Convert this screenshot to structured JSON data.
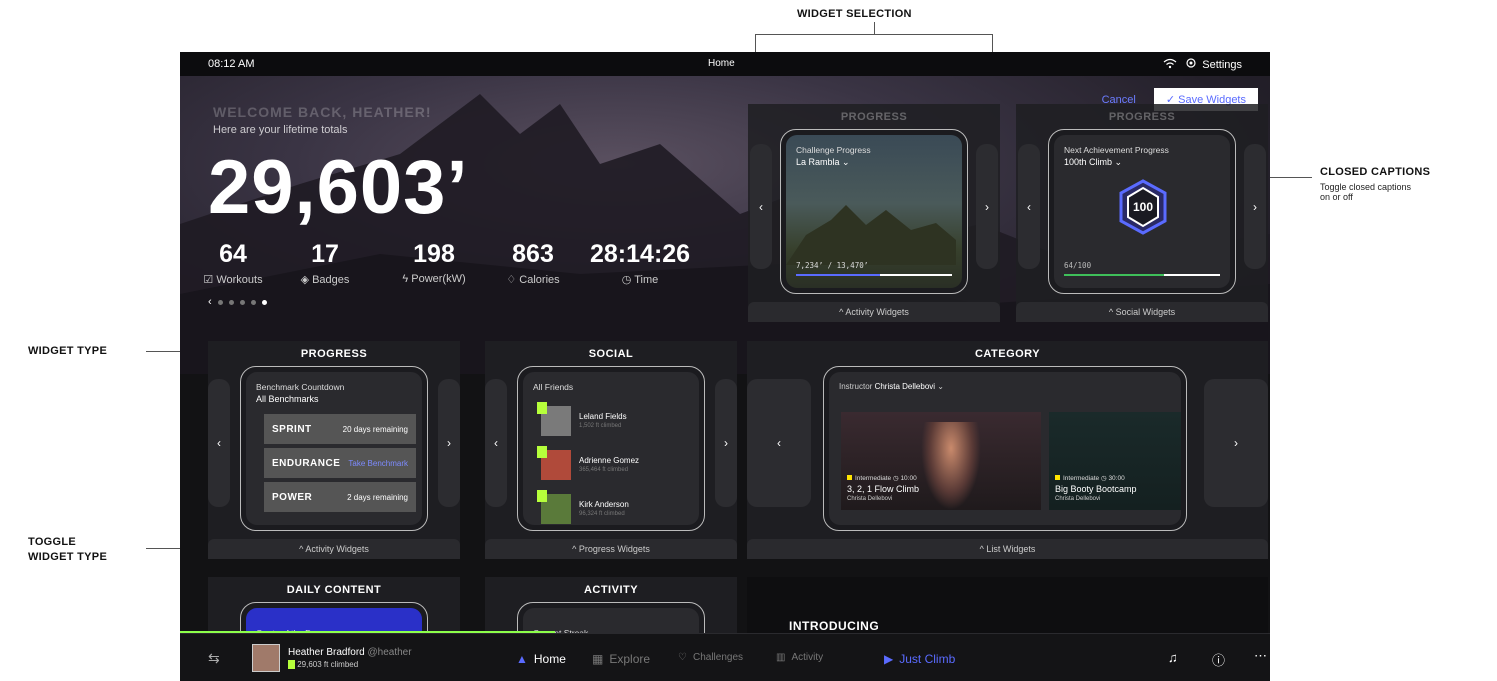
{
  "annotations": {
    "widget_selection": "WIDGET SELECTION",
    "closed_captions_title": "CLOSED CAPTIONS",
    "closed_captions_sub1": "Toggle closed captions",
    "closed_captions_sub2": "on or off",
    "widget_type": "WIDGET TYPE",
    "toggle_widget_type_1": "TOGGLE",
    "toggle_widget_type_2": "WIDGET TYPE"
  },
  "status": {
    "time": "08:12 AM",
    "page": "Home",
    "settings_label": "Settings"
  },
  "hero": {
    "welcome": "WELCOME BACK, HEATHER!",
    "subtitle": "Here are your lifetime totals",
    "total": "29,603’",
    "stats": [
      {
        "value": "64",
        "label": "Workouts",
        "icon": "check-square-icon"
      },
      {
        "value": "17",
        "label": "Badges",
        "icon": "badge-icon"
      },
      {
        "value": "198",
        "label": "Power(kW)",
        "icon": "bolt-icon"
      },
      {
        "value": "863",
        "label": "Calories",
        "icon": "flame-icon"
      },
      {
        "value": "28:14:26",
        "label": "Time",
        "icon": "stopwatch-icon"
      }
    ]
  },
  "edit": {
    "cancel": "Cancel",
    "save": "Save Widgets"
  },
  "widget_picker": [
    {
      "head": "PROGRESS",
      "label": "Challenge Progress",
      "value": "La Rambla",
      "readout": "7,234’ / 13,470’",
      "progress": 0.54,
      "footer": "Activity Widgets"
    },
    {
      "head": "PROGRESS",
      "label": "Next Achievement Progress",
      "value": "100th Climb",
      "badge": "100",
      "readout": "64/100",
      "progress": 0.64,
      "footer": "Social Widgets"
    }
  ],
  "panels": {
    "progress": {
      "head": "PROGRESS",
      "label": "Benchmark Countdown",
      "value": "All Benchmarks",
      "rows": [
        {
          "name": "SPRINT",
          "status": "20 days remaining"
        },
        {
          "name": "ENDURANCE",
          "status": "Take Benchmark"
        },
        {
          "name": "POWER",
          "status": "2 days remaining"
        }
      ],
      "footer": "Activity Widgets"
    },
    "social": {
      "head": "SOCIAL",
      "label": "All Friends",
      "friends": [
        {
          "name": "Leland Fields",
          "feet": "1,502 ft climbed"
        },
        {
          "name": "Adrienne Gomez",
          "feet": "365,464 ft climbed"
        },
        {
          "name": "Kirk Anderson",
          "feet": "96,324 ft climbed"
        }
      ],
      "footer": "Progress Widgets"
    },
    "category": {
      "head": "CATEGORY",
      "filter_label": "Instructor",
      "filter_value": "Christa Dellebovi",
      "classes": [
        {
          "level": "Intermediate",
          "duration": "10:00",
          "title": "3, 2, 1 Flow Climb",
          "instructor": "Christa Dellebovi"
        },
        {
          "level": "Intermediate",
          "duration": "30:00",
          "title": "Big Booty Bootcamp",
          "instructor": "Christa Dellebovi"
        }
      ],
      "footer": "List Widgets"
    },
    "daily": {
      "head": "DAILY CONTENT",
      "label": "Quote of the Day"
    },
    "activity": {
      "head": "ACTIVITY",
      "label": "Current Streak"
    },
    "intro": {
      "text": "INTRODUCING"
    }
  },
  "bottom_nav": {
    "user_name": "Heather Bradford",
    "user_handle": "@heather",
    "user_feet": "29,603 ft climbed",
    "items": [
      "Home",
      "Explore",
      "Challenges",
      "Activity"
    ],
    "just_climb": "Just Climb"
  },
  "colors": {
    "accent": "#5a6bff",
    "green": "#8dff4a",
    "lime": "#b6ff3b"
  }
}
